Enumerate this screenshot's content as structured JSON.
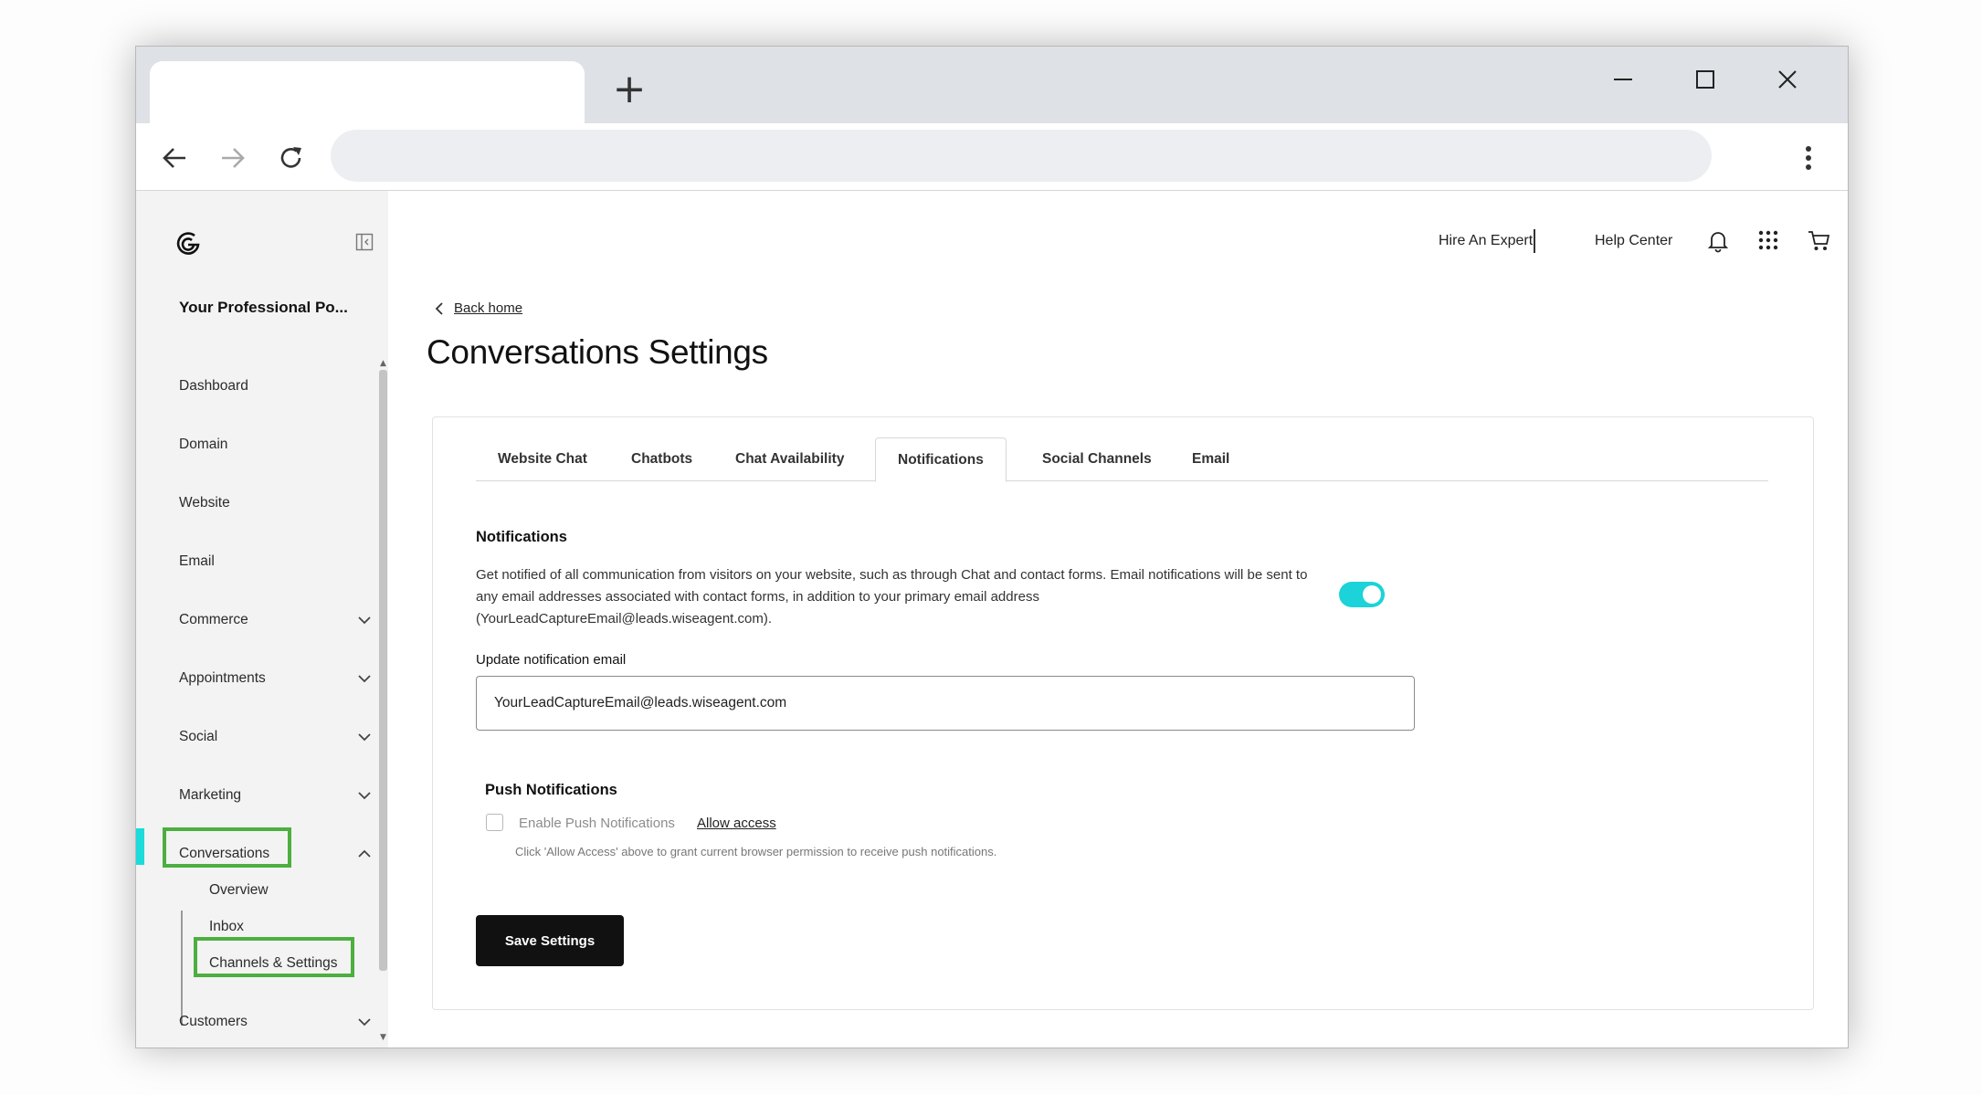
{
  "browser": {
    "tab_title": "",
    "new_tab_label": "+",
    "address": ""
  },
  "sidebar": {
    "business_name": "Your Professional Po...",
    "items": [
      {
        "label": "Dashboard"
      },
      {
        "label": "Domain"
      },
      {
        "label": "Website"
      },
      {
        "label": "Email"
      },
      {
        "label": "Commerce"
      },
      {
        "label": "Appointments"
      },
      {
        "label": "Social"
      },
      {
        "label": "Marketing"
      },
      {
        "label": "Conversations"
      },
      {
        "label": "Customers"
      }
    ],
    "conversations_sub": [
      {
        "label": "Overview"
      },
      {
        "label": "Inbox"
      },
      {
        "label": "Channels & Settings"
      }
    ],
    "accent_color": "#1bdbdb",
    "highlight_color": "#4caf3f"
  },
  "header": {
    "hire_expert": "Hire An Expert",
    "help_center": "Help Center"
  },
  "page": {
    "back_link": "Back home",
    "title": "Conversations Settings",
    "tabs": [
      {
        "label": "Website Chat"
      },
      {
        "label": "Chatbots"
      },
      {
        "label": "Chat Availability"
      },
      {
        "label": "Notifications"
      },
      {
        "label": "Social Channels"
      },
      {
        "label": "Email"
      }
    ],
    "active_tab": "Notifications",
    "notifications": {
      "title": "Notifications",
      "description": "Get notified of all communication from visitors on your website, such as through Chat and contact forms. Email notifications will be sent to any email addresses associated with contact forms, in addition to your primary email address (YourLeadCaptureEmail@leads.wiseagent.com).",
      "enabled": true,
      "toggle_color": "#1bd3d8",
      "email_label": "Update notification email",
      "email_value": "YourLeadCaptureEmail@leads.wiseagent.com"
    },
    "push": {
      "title": "Push Notifications",
      "enable_label": "Enable Push Notifications",
      "allow_link": "Allow access",
      "hint": "Click 'Allow Access' above to grant current browser permission to receive push notifications.",
      "checked": false
    },
    "save_label": "Save Settings"
  }
}
